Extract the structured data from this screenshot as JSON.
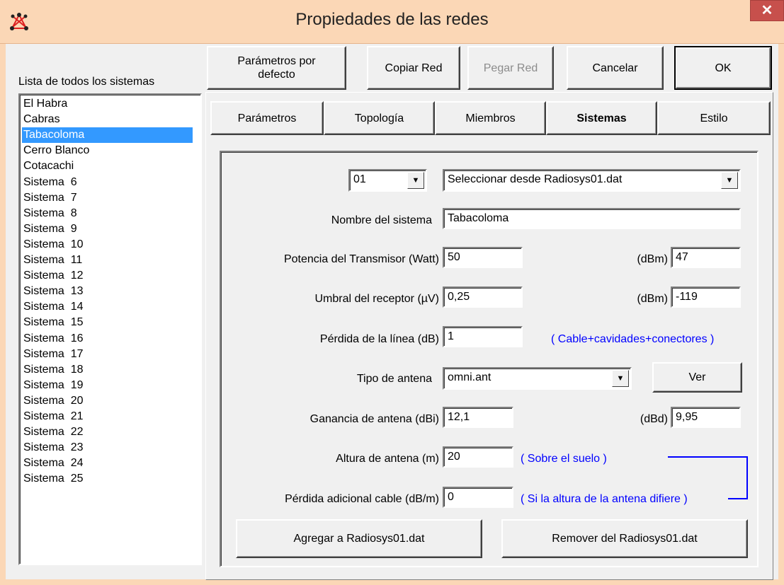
{
  "window": {
    "title": "Propiedades de las redes",
    "close": "✕"
  },
  "list": {
    "label": "Lista de todos los sistemas",
    "items": [
      "El Habra",
      "Cabras",
      "Tabacoloma",
      "Cerro Blanco",
      "Cotacachi",
      "Sistema  6",
      "Sistema  7",
      "Sistema  8",
      "Sistema  9",
      "Sistema  10",
      "Sistema  11",
      "Sistema  12",
      "Sistema  13",
      "Sistema  14",
      "Sistema  15",
      "Sistema  16",
      "Sistema  17",
      "Sistema  18",
      "Sistema  19",
      "Sistema  20",
      "Sistema  21",
      "Sistema  22",
      "Sistema  23",
      "Sistema  24",
      "Sistema  25"
    ],
    "selected": "Tabacoloma"
  },
  "toolbar": {
    "defaults_label": "Parámetros por defecto",
    "copy_label": "Copiar Red",
    "paste_label": "Pegar Red",
    "cancel_label": "Cancelar",
    "ok_label": "OK"
  },
  "tabs": [
    "Parámetros",
    "Topología",
    "Miembros",
    "Sistemas",
    "Estilo"
  ],
  "active_tab": "Sistemas",
  "system": {
    "number": "01",
    "select_from": "Seleccionar desde Radiosys01.dat",
    "name_label": "Nombre del sistema",
    "name_value": "Tabacoloma",
    "power_label": "Potencia del Transmisor (Watt)",
    "power_value": "50",
    "power_dbm_label": "(dBm)",
    "power_dbm_value": "47",
    "threshold_label": "Umbral del receptor (µV)",
    "threshold_value": "0,25",
    "threshold_dbm_label": "(dBm)",
    "threshold_dbm_value": "-119",
    "line_loss_label": "Pérdida de la línea (dB)",
    "line_loss_value": "1",
    "line_loss_note": "( Cable+cavidades+conectores )",
    "antenna_type_label": "Tipo de antena",
    "antenna_type_value": "omni.ant",
    "view_label": "Ver",
    "gain_label": "Ganancia de antena (dBi)",
    "gain_value": "12,1",
    "gain_dbd_label": "(dBd)",
    "gain_dbd_value": "9,95",
    "height_label": "Altura de antena (m)",
    "height_value": "20",
    "height_note": "( Sobre el suelo )",
    "extra_loss_label": "Pérdida adicional cable (dB/m)",
    "extra_loss_value": "0",
    "extra_loss_note": "( Si la altura de la antena difiere )",
    "add_label": "Agregar a Radiosys01.dat",
    "remove_label": "Remover del Radiosys01.dat"
  },
  "colors": {
    "selection": "#3399ff",
    "note": "#0000ff",
    "close": "#c7504c",
    "titlebar": "#fbd7b6"
  }
}
